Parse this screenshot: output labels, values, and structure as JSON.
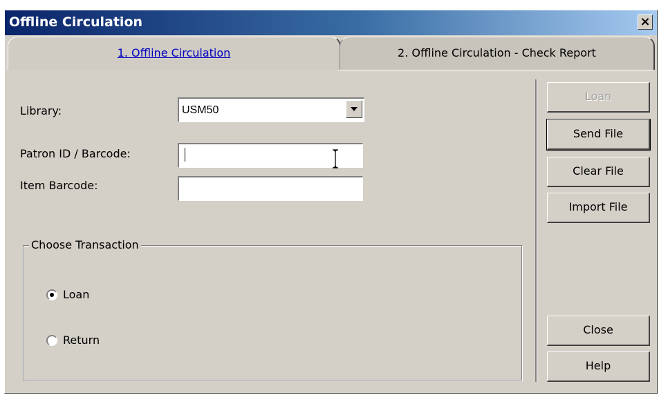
{
  "window": {
    "title": "Offline Circulation",
    "close_glyph": "×"
  },
  "tabs": [
    {
      "label": "1. Offline Circulation",
      "active": true
    },
    {
      "label": "2. Offline Circulation - Check Report",
      "active": false
    }
  ],
  "form": {
    "library_label": "Library:",
    "library_value": "USM50",
    "patron_label": "Patron ID / Barcode:",
    "patron_value": "",
    "item_label": "Item Barcode:",
    "item_value": ""
  },
  "transaction": {
    "legend": "Choose Transaction",
    "options": [
      {
        "label": "Loan",
        "checked": true
      },
      {
        "label": "Return",
        "checked": false
      }
    ]
  },
  "buttons": {
    "loan": "Loan",
    "send_file": "Send File",
    "clear_file": "Clear File",
    "import_file": "Import File",
    "close": "Close",
    "help": "Help"
  },
  "icons": {
    "dropdown": "chevron-down-icon",
    "cursor": "ibeam-cursor-icon"
  }
}
